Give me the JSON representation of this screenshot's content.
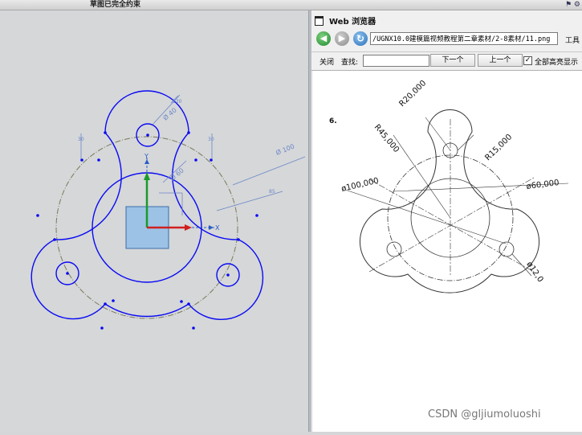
{
  "status_bar": {
    "message": "草图已完全约束",
    "icons": "⚑ ⚙"
  },
  "sketch": {
    "dimensions": {
      "d_hole": "Ø 40",
      "d_inner": "Ø 60",
      "d_pitch": "Ø 100",
      "angle": "120",
      "angle_small": "30",
      "ref": "85",
      "x_axis": "X",
      "y_axis": "Y"
    },
    "colors": {
      "profile": "#0a0af2",
      "centerline": "#7a7a5a",
      "annotation": "#6b86c6",
      "datum_fill": "#9cc2e6"
    }
  },
  "browser": {
    "title": "Web 浏览器",
    "url": "/UGNX10.0建模篇视频教程第二章素材/2-8素材/11.png",
    "tools_label": "工具",
    "find": {
      "close_label": "关闭",
      "find_label": "查找:",
      "next_label": "下一个",
      "prev_label": "上一个",
      "highlight_all_label": "全部高亮显示",
      "highlight_checked": true
    }
  },
  "image": {
    "number": "6.",
    "labels": {
      "r20": "R20,000",
      "r45": "R45,000",
      "r15": "R15,000",
      "d100": "ø100,000",
      "d60": "ø60,000",
      "d12": "ø12,0"
    }
  },
  "watermark": "CSDN @gljiumoluoshi"
}
